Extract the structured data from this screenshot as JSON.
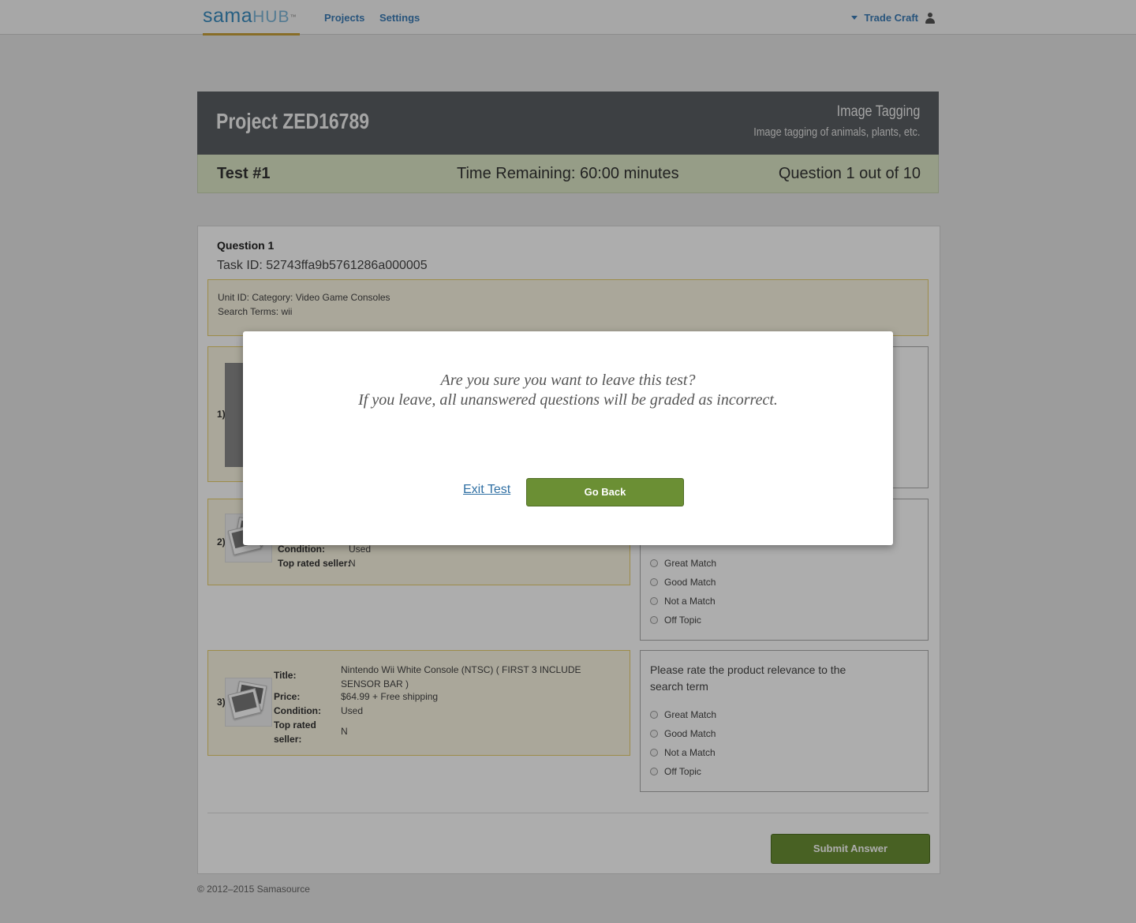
{
  "nav": {
    "logo_sama": "sama",
    "logo_hub": "HUB",
    "logo_tm": "™",
    "projects": "Projects",
    "settings": "Settings",
    "user": "Trade Craft"
  },
  "project": {
    "title": "Project ZED16789",
    "type": "Image Tagging",
    "description": "Image tagging of animals, plants, etc."
  },
  "test": {
    "name": "Test #1",
    "time_remaining": "Time Remaining: 60:00 minutes",
    "progress": "Question 1 out of 10"
  },
  "question": {
    "label": "Question 1",
    "task_id": "Task ID: 52743ffa9b5761286a000005",
    "unit_line1": "Unit ID: Category: Video Game Consoles",
    "unit_line2": "Search Terms: wii"
  },
  "items": [
    {
      "num": "1)"
    },
    {
      "num": "2)",
      "condition_label": "Condition:",
      "condition": "Used",
      "top_rated_label": "Top rated seller:",
      "top_rated": "N"
    },
    {
      "num": "3)",
      "title_label": "Title:",
      "title": "Nintendo Wii White Console (NTSC) ( FIRST 3 INCLUDE SENSOR BAR )",
      "price_label": "Price:",
      "price": "$64.99 + Free shipping",
      "condition_label": "Condition:",
      "condition": "Used",
      "top_rated_label_1": "Top rated",
      "top_rated_label_2": "seller:",
      "top_rated": "N"
    }
  ],
  "rating": {
    "question": "Please rate the product relevance to the search term",
    "options": [
      "Great Match",
      "Good Match",
      "Not a Match",
      "Off Topic"
    ]
  },
  "submit_label": "Submit Answer",
  "footer": "© 2012–2015 Samasource",
  "modal": {
    "line1": "Are you sure you want to leave this test?",
    "line2": "If you leave, all unanswered questions will be graded as incorrect.",
    "exit_label": "Exit Test",
    "back_label": "Go Back"
  },
  "colors": {
    "brand_blue": "#3b7db7",
    "button_green": "#6b8f34",
    "test_bar": "#dde8c8",
    "header_dark": "#5b5f63",
    "item_border": "#e7cf6c"
  }
}
